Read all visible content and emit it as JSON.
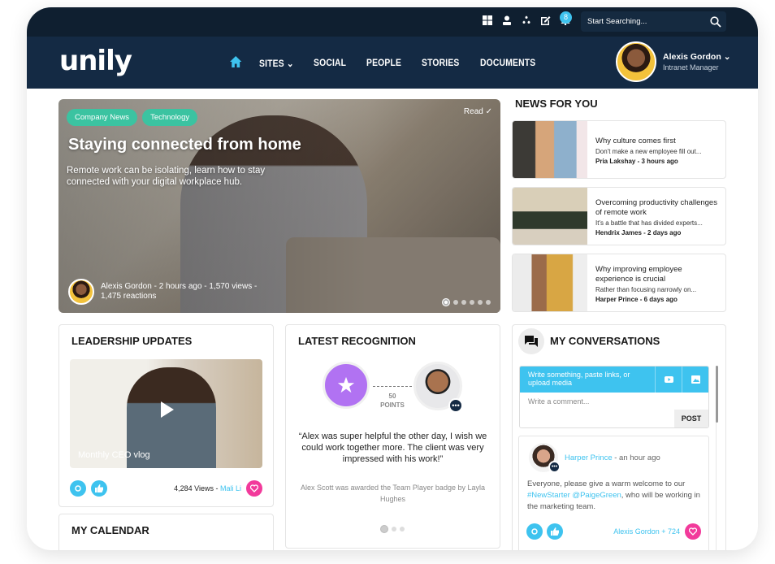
{
  "topbar": {
    "icons": [
      "windows-icon",
      "user-icon",
      "stars-icon",
      "edit-icon",
      "bell-icon"
    ],
    "notification_count": "8",
    "search_placeholder": "Start Searching..."
  },
  "nav": {
    "logo": "unily",
    "items": [
      {
        "label": "SITES",
        "has_dropdown": true
      },
      {
        "label": "SOCIAL"
      },
      {
        "label": "PEOPLE"
      },
      {
        "label": "STORIES"
      },
      {
        "label": "DOCUMENTS"
      }
    ],
    "user": {
      "name": "Alexis Gordon",
      "role": "Intranet Manager"
    }
  },
  "hero": {
    "tags": [
      "Company News",
      "Technology"
    ],
    "title": "Staying connected from home",
    "subtitle": "Remote work can be isolating, learn how to stay connected with your digital workplace hub.",
    "read_label": "Read ✓",
    "meta": "Alexis Gordon - 2 hours ago  - 1,570 views - 1,475 reactions",
    "slide_count": 6,
    "active_slide": 1
  },
  "news": {
    "title": "NEWS FOR YOU",
    "items": [
      {
        "title": "Why culture comes first",
        "desc": "Don't make a new employee fill out...",
        "meta": "Pria Lakshay - 3 hours ago"
      },
      {
        "title": "Overcoming productivity challenges of remote work",
        "desc": "It's a battle that has divided experts...",
        "meta": "Hendrix James - 2 days ago"
      },
      {
        "title": "Why improving employee experience is crucial",
        "desc": "Rather than focusing narrowly on...",
        "meta": "Harper Prince - 6 days ago"
      }
    ]
  },
  "leadership": {
    "title": "LEADERSHIP UPDATES",
    "video_caption": "Monthly CEO vlog",
    "views": "4,284 Views - ",
    "author": "Mali Li"
  },
  "recognition": {
    "title": "LATEST RECOGNITION",
    "points": "50",
    "points_label": "POINTS",
    "quote": "“Alex was super helpful the other day, I wish we could work together more. The client was very impressed with his work!”",
    "awarded": "Alex Scott was awarded the Team Player badge by Layla Hughes",
    "more": "•••"
  },
  "calendar": {
    "title": "MY CALENDAR"
  },
  "conversations": {
    "title": "MY CONVERSATIONS",
    "composer_prompt": "Write something, paste links, or upload media",
    "comment_placeholder": "Write a comment...",
    "post_label": "POST",
    "post": {
      "author": "Harper Prince",
      "time": " - an hour ago",
      "text_before": "Everyone, please give a warm welcome to our ",
      "tags": "#NewStarter @PaigeGreen",
      "text_after": ", who will be working in the marketing team.",
      "reactions": "Alexis Gordon + 724"
    }
  },
  "colors": {
    "accent": "#3ec3ef",
    "nav": "#142a44",
    "topbar": "#0f1f30",
    "tag": "#3bc3a1",
    "like": "#f23a9b",
    "badge": "#b172f2"
  }
}
